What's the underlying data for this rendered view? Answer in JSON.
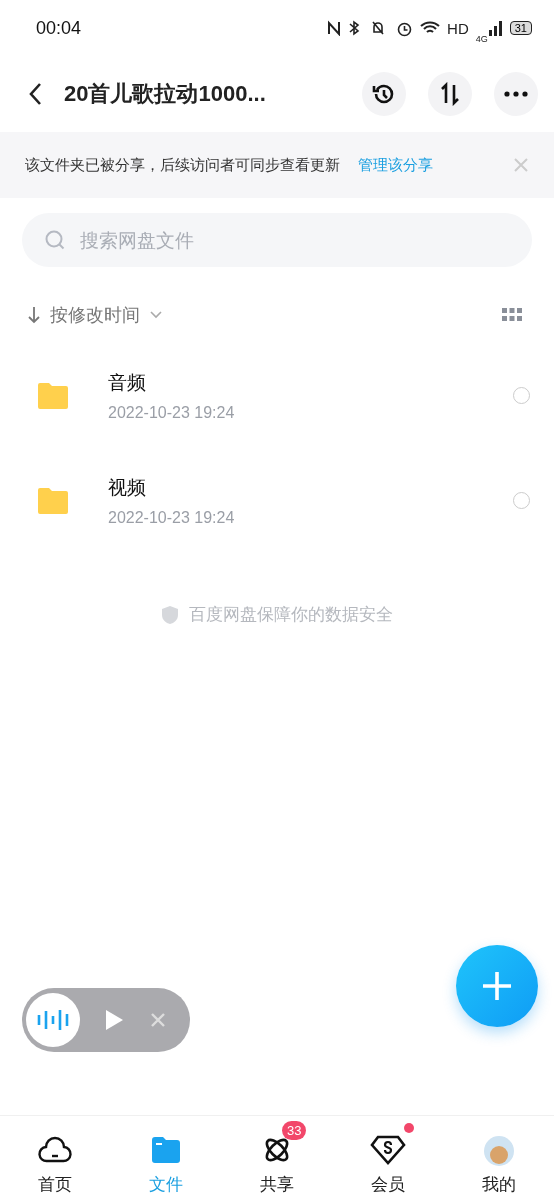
{
  "status_bar": {
    "time": "00:04",
    "hd": "HD",
    "network": "4G",
    "battery": "31"
  },
  "header": {
    "title": "20首儿歌拉动1000..."
  },
  "share_banner": {
    "message": "该文件夹已被分享，后续访问者可同步查看更新",
    "link": "管理该分享"
  },
  "search": {
    "placeholder": "搜索网盘文件"
  },
  "sort": {
    "label": "按修改时间"
  },
  "files": [
    {
      "name": "音频",
      "date": "2022-10-23  19:24",
      "selected": false
    },
    {
      "name": "视频",
      "date": "2022-10-23  19:24",
      "selected": false
    }
  ],
  "footer_note": "百度网盘保障你的数据安全",
  "tabs": [
    {
      "kind": "home",
      "label": "首页",
      "selected": false
    },
    {
      "kind": "files",
      "label": "文件",
      "selected": true
    },
    {
      "kind": "share",
      "label": "共享",
      "selected": false,
      "badge": "33"
    },
    {
      "kind": "vip",
      "label": "会员",
      "selected": false,
      "dot": true
    },
    {
      "kind": "me",
      "label": "我的",
      "selected": false
    }
  ]
}
